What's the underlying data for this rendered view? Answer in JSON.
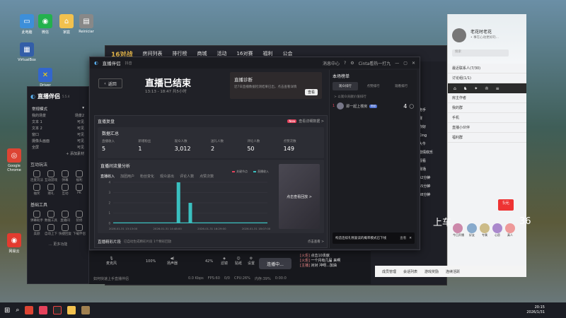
{
  "desktop": {
    "icons": [
      {
        "label": "此电脑",
        "color": "#3d8fd9",
        "glyph": "▭"
      },
      {
        "label": "微信",
        "color": "#23b14d",
        "glyph": "◉"
      },
      {
        "label": "家庭",
        "color": "#f2c14e",
        "glyph": "⌂"
      },
      {
        "label": "Reiniciar",
        "color": "#888",
        "glyph": "▤"
      },
      {
        "label": "VirtualBox",
        "color": "#335ea8",
        "glyph": "▦"
      },
      {
        "label": "Driver",
        "color": "#3366cc",
        "glyph": "✕"
      },
      {
        "label": "Google Chrome",
        "color": "#dd4433",
        "glyph": "◎"
      },
      {
        "label": "网易云",
        "color": "#e33b2f",
        "glyph": "◉"
      }
    ]
  },
  "bg_page": {
    "logo": "16对战",
    "nav": [
      "房间列表",
      "排行榜",
      "商城",
      "活动",
      "16对赛",
      "福利",
      "公会"
    ],
    "side_list": [
      "电手",
      "赛",
      "队",
      "开始心",
      "King",
      "赛",
      "激情",
      "剧",
      "剧"
    ]
  },
  "assistant": {
    "title": "直播伴侣",
    "version": "5.5.4",
    "mode": "常规模式",
    "scene_tabs": [
      "我的场景",
      "场景2"
    ],
    "sources": [
      {
        "name": "文本 1",
        "state": "可见"
      },
      {
        "name": "文本 2",
        "state": "可见"
      },
      {
        "name": "窗口",
        "state": "可见"
      },
      {
        "name": "摄像头画面",
        "state": "可见"
      },
      {
        "name": "全屏",
        "state": "可见"
      }
    ],
    "add_source": "+ 添加素材",
    "section_interact": "互动玩法",
    "interact_items": [
      "连麦玩法",
      "互动游戏",
      "弹幕",
      "福利",
      "抽奖",
      "赠礼",
      "互动",
      "PK"
    ],
    "section_tools": "基础工具",
    "tool_items": [
      "弹幕助手",
      "数据工具",
      "直播间",
      "装修",
      "美颜",
      "自动上下",
      "快捷回复",
      "下载伴侣"
    ],
    "more": "… 更多功能"
  },
  "modal": {
    "app": "直播伴侣",
    "app_sub": "抖音",
    "top_right": [
      "消息中心",
      "帮助",
      "设置",
      "Cinta看热一打九"
    ],
    "back": "返回",
    "title": "直播已结束",
    "time": "13:13 - 18:47 共5小时",
    "diag_title": "直播诊断",
    "diag_desc": "近7日直播数据检测结果已出，点击查看详情",
    "diag_btn": "查看",
    "review_title": "直播复盘",
    "review_new": "New",
    "review_more": "查看详细数据 >",
    "summary_title": "数据汇总",
    "stats": [
      {
        "k": "直播收入",
        "v": "5"
      },
      {
        "k": "新增粉丝",
        "v": "1"
      },
      {
        "k": "观众人数",
        "v": "3,012"
      },
      {
        "k": "送礼人数",
        "v": "2"
      },
      {
        "k": "评论人数",
        "v": "50"
      },
      {
        "k": "点赞次数",
        "v": "149"
      }
    ],
    "analysis_title": "直播间流量分析",
    "legend": [
      "关键节点",
      "直播收入"
    ],
    "tabs": [
      "直播收入",
      "加团用户",
      "粉丝变化",
      "观众进出",
      "评论人数",
      "点赞次数"
    ],
    "replay": "点击查看回放 >",
    "clips_title": "直播精彩片段",
    "clips_desc": "已自动生成精彩片段 1个精彩回放",
    "clips_more": "点击查看 >",
    "right_title": "本场榜单",
    "right_tabs": [
      "观众排行",
      "点赞排行",
      "观看排行"
    ],
    "right_note": "> 以观众贡献价值排行",
    "rank": [
      {
        "n": "1",
        "name": "即一起上楼房",
        "tag": "粉丝",
        "count": "4"
      }
    ],
    "toast": "构造连续礼物复读的概率模式已下线",
    "toast_action": "查看"
  },
  "chart_data": {
    "type": "bar",
    "title": "",
    "categories": [
      "2026-01-31 13:13:00",
      "2026-01-31 14:48:00",
      "2026-01-31 16:29:00",
      "2026-01-31 18:07:00"
    ],
    "x": [
      0,
      0.1,
      0.2,
      0.3,
      0.4,
      0.45,
      0.5,
      0.55,
      0.6,
      0.7,
      0.8,
      0.9,
      1.0
    ],
    "values": [
      0,
      0,
      0,
      0,
      0,
      4,
      2,
      0,
      0,
      0,
      0,
      0,
      0
    ],
    "ylim": [
      0,
      4
    ],
    "yticks": [
      "0",
      "1",
      "2",
      "3",
      "4"
    ],
    "xlabel": "",
    "ylabel": ""
  },
  "ctrlbar": {
    "items": [
      "麦克风",
      "100%",
      "扬声器",
      "42%",
      "滤镜",
      "贴纸",
      "设置"
    ],
    "start": "连播中...",
    "hint": "如何快速上手直播伴侣",
    "status": [
      "0.0 Kbps",
      "FPS:60",
      "0/0",
      "CPU:26%",
      "内存:39%",
      "0:00:0"
    ]
  },
  "bchat": {
    "lines": [
      {
        "tag": "[火炬]",
        "text": "点击10贡献"
      },
      {
        "tag": "[火炬]",
        "text": "一个月有几届 来啊"
      },
      {
        "tag": "[主播]",
        "text": "对对 冲呀...加油"
      }
    ]
  },
  "qq": {
    "name": "老花时老花",
    "sig": "• 事在心动更好的...",
    "search": "搜索",
    "lines": [
      "最近联系人(7/30)",
      "讨论组(1/1)",
      "房主作者",
      "我的群",
      "手机",
      "直播小伙伴",
      "福利群"
    ],
    "promo": "5元",
    "gifts": [
      "今日开播",
      "好友",
      "专属",
      "心愿",
      "真人"
    ]
  },
  "chat_side": [
    "电手",
    "赛",
    "你好",
    "King",
    "大牛",
    "激情欢乐",
    "观看",
    "赛场",
    "42分钟",
    "55分钟",
    "38分钟"
  ],
  "floats": {
    "left": "上车",
    "right": "36"
  },
  "bottom_list": [
    "成员管理",
    "会话列表",
    "游戏奖励",
    "连续活跃"
  ],
  "taskbar": {
    "time": "20:15",
    "date": "2026/1/31"
  }
}
